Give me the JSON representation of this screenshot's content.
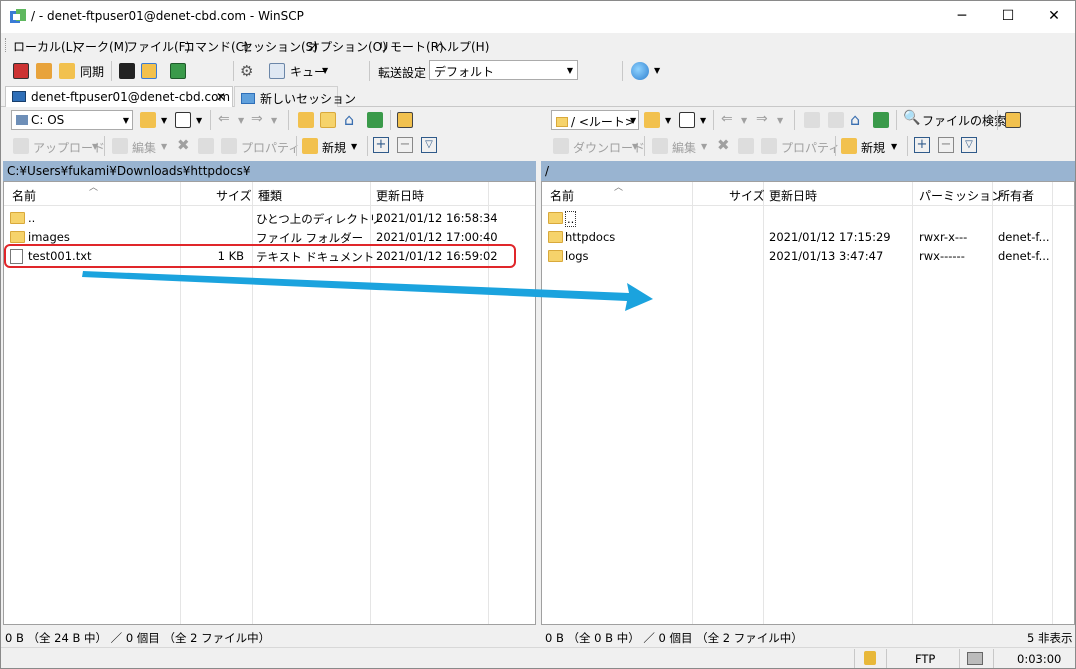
{
  "window": {
    "title": "/ - denet-ftpuser01@denet-cbd.com - WinSCP",
    "minimize": "─",
    "maximize": "☐",
    "close": "✕"
  },
  "menu": [
    "ローカル(L)",
    "マーク(M)",
    "ファイル(F)",
    "コマンド(C)",
    "セッション(S)",
    "オプション(O)",
    "リモート(R)",
    "ヘルプ(H)"
  ],
  "toolbar": {
    "sync_label": "同期",
    "queue_label": "キュー",
    "transfer_settings_label": "転送設定",
    "transfer_preset": "デフォルト"
  },
  "tabs": {
    "session": "denet-ftpuser01@denet-cbd.com",
    "new_session": "新しいセッション"
  },
  "local": {
    "drive": "C: OS",
    "upload_label": "アップロード",
    "edit_label": "編集",
    "properties_label": "プロパティ",
    "new_label": "新規",
    "path": "C:¥Users¥fukami¥Downloads¥httpdocs¥",
    "columns": {
      "name": "名前",
      "size": "サイズ",
      "type": "種類",
      "modified": "更新日時"
    },
    "rows": [
      {
        "name": "..",
        "size": "",
        "type": "ひとつ上のディレクトリ",
        "modified": "2021/01/12  16:58:34",
        "icon": "parent-dir-icon"
      },
      {
        "name": "images",
        "size": "",
        "type": "ファイル フォルダー",
        "modified": "2021/01/12  17:00:40",
        "icon": "folder-icon"
      },
      {
        "name": "test001.txt",
        "size": "1 KB",
        "type": "テキスト ドキュメント",
        "modified": "2021/01/12  16:59:02",
        "icon": "text-file-icon"
      }
    ],
    "status": "0 B （全 24 B 中） ／ 0 個目 （全 2 ファイル中）"
  },
  "remote": {
    "path_combo": "/ <ルート>",
    "find_files_label": "ファイルの検索",
    "download_label": "ダウンロード",
    "edit_label": "編集",
    "properties_label": "プロパティ",
    "new_label": "新規",
    "path": "/",
    "columns": {
      "name": "名前",
      "size": "サイズ",
      "modified": "更新日時",
      "permissions": "パーミッション",
      "owner": "所有者"
    },
    "rows": [
      {
        "name": "..",
        "modified": "",
        "permissions": "",
        "owner": "",
        "icon": "parent-dir-icon"
      },
      {
        "name": "httpdocs",
        "modified": "2021/01/12 17:15:29",
        "permissions": "rwxr-x---",
        "owner": "denet-f...",
        "icon": "folder-icon"
      },
      {
        "name": "logs",
        "modified": "2021/01/13 3:47:47",
        "permissions": "rwx------",
        "owner": "denet-f...",
        "icon": "folder-icon"
      }
    ],
    "status": "0 B （全 0 B 中） ／ 0 個目 （全 2 ファイル中）",
    "hidden": "5 非表示"
  },
  "bottom": {
    "protocol": "FTP",
    "elapsed": "0:03:00"
  },
  "colors": {
    "path_bar": "#99b4d1",
    "highlight": "#e0262a",
    "arrow": "#1ba3de"
  }
}
